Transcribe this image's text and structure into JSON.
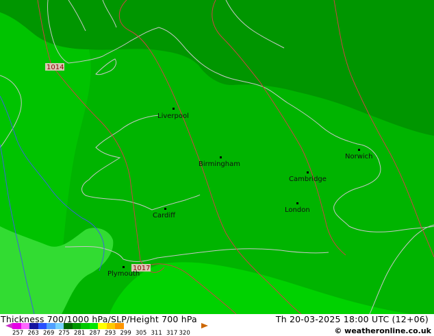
{
  "map": {
    "cities": [
      {
        "name": "Liverpool"
      },
      {
        "name": "Birmingham"
      },
      {
        "name": "Norwich"
      },
      {
        "name": "Cambridge"
      },
      {
        "name": "London"
      },
      {
        "name": "Cardiff"
      },
      {
        "name": "Plymouth"
      }
    ],
    "isobar_labels": [
      "1014",
      "1017"
    ],
    "colors": {
      "thickness_dark": "#009600",
      "thickness_mid": "#00b400",
      "thickness_light": "#00d200",
      "thickness_pale": "#32e632",
      "coastline": "#c8c8c8",
      "isobar": "#cc4444",
      "river": "#3c64dc"
    }
  },
  "footer": {
    "title": "Thickness 700/1000 hPa/SLP/Height 700 hPa",
    "valid_time": "Th 20-03-2025 18:00 UTC (12+06)",
    "credit": "© weatheronline.co.uk"
  },
  "legend": {
    "ticks": [
      "257",
      "263",
      "269",
      "275",
      "281",
      "287",
      "293",
      "299",
      "305",
      "311",
      "317",
      "320"
    ],
    "colors": [
      "#e600e6",
      "#ff66ff",
      "#1414a0",
      "#2850ff",
      "#50a0ff",
      "#78d2ff",
      "#006400",
      "#009600",
      "#00c800",
      "#00e600",
      "#ffff00",
      "#ffc800",
      "#ff9600"
    ]
  }
}
